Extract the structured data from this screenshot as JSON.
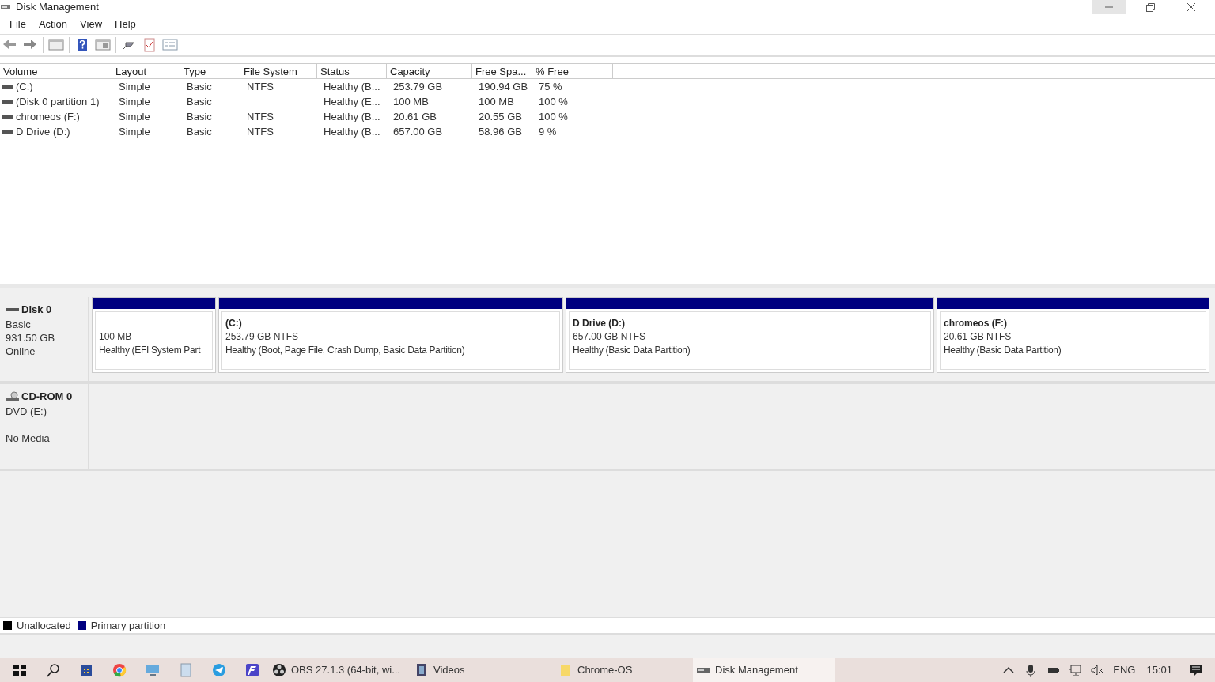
{
  "window": {
    "title": "Disk Management",
    "controls": [
      {
        "kind": "minimize",
        "hovered": true
      },
      {
        "kind": "restore",
        "hovered": false
      },
      {
        "kind": "close",
        "hovered": false
      }
    ]
  },
  "menu": [
    "File",
    "Action",
    "View",
    "Help"
  ],
  "toolbar": [
    {
      "kind": "back"
    },
    {
      "kind": "forward"
    },
    {
      "kind": "sep"
    },
    {
      "kind": "panel"
    },
    {
      "kind": "sep"
    },
    {
      "kind": "help"
    },
    {
      "kind": "panel2"
    },
    {
      "kind": "sep"
    },
    {
      "kind": "connect"
    },
    {
      "kind": "check"
    },
    {
      "kind": "list"
    }
  ],
  "table": {
    "columns": [
      "Volume",
      "Layout",
      "Type",
      "File System",
      "Status",
      "Capacity",
      "Free Spa...",
      "% Free"
    ],
    "rows": [
      [
        "(C:)",
        "Simple",
        "Basic",
        "NTFS",
        "Healthy (B...",
        "253.79 GB",
        "190.94 GB",
        "75 %"
      ],
      [
        "(Disk 0 partition 1)",
        "Simple",
        "Basic",
        "",
        "Healthy (E...",
        "100 MB",
        "100 MB",
        "100 %"
      ],
      [
        "chromeos (F:)",
        "Simple",
        "Basic",
        "NTFS",
        "Healthy (B...",
        "20.61 GB",
        "20.55 GB",
        "100 %"
      ],
      [
        "D Drive (D:)",
        "Simple",
        "Basic",
        "NTFS",
        "Healthy (B...",
        "657.00 GB",
        "58.96 GB",
        "9 %"
      ]
    ]
  },
  "disks": [
    {
      "kind": "disk",
      "name": "Disk 0",
      "lines": [
        "Basic",
        "931.50 GB"
      ],
      "state": "Online",
      "partitions": [
        {
          "size": "100 MB",
          "status": "Healthy (EFI System Part"
        },
        {
          "label": "(C:)",
          "size": "253.79 GB NTFS",
          "status": "Healthy (Boot, Page File, Crash Dump, Basic Data Partition)"
        },
        {
          "label": "D Drive  (D:)",
          "size": "657.00 GB NTFS",
          "status": "Healthy (Basic Data Partition)"
        },
        {
          "label": "chromeos  (F:)",
          "size": "20.61 GB NTFS",
          "status": "Healthy (Basic Data Partition)"
        }
      ]
    },
    {
      "kind": "cdrom",
      "name": "CD-ROM 0",
      "lines": [
        "DVD (E:)"
      ],
      "state": "No Media"
    }
  ],
  "legend": [
    {
      "label": "Unallocated",
      "color": "#000000"
    },
    {
      "label": "Primary partition",
      "color": "#000080"
    }
  ],
  "taskbar": {
    "icons": [
      {
        "kind": "start"
      },
      {
        "kind": "search"
      },
      {
        "kind": "store"
      },
      {
        "kind": "chrome"
      },
      {
        "kind": "computer"
      },
      {
        "kind": "notepad"
      },
      {
        "kind": "telegram"
      },
      {
        "kind": "fapp"
      }
    ],
    "tasks": [
      {
        "kind": "obs",
        "label": "OBS 27.1.3 (64-bit, wi...",
        "selected": false
      },
      {
        "kind": "videos",
        "label": "Videos",
        "selected": false
      },
      {
        "kind": "folder",
        "label": "Chrome-OS",
        "selected": false
      },
      {
        "kind": "disk",
        "label": "Disk Management",
        "selected": true
      }
    ],
    "tray": {
      "language": "ENG",
      "time": "15:01"
    }
  }
}
